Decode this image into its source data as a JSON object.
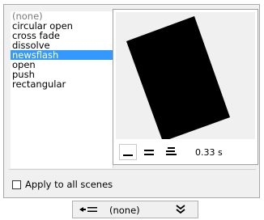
{
  "transitions": {
    "items": [
      "(none)",
      "circular open",
      "cross fade",
      "dissolve",
      "newsflash",
      "open",
      "push",
      "rectangular"
    ],
    "selected_index": 4
  },
  "preview": {
    "speeds": [
      "slow-icon",
      "medium-icon",
      "fast-icon"
    ],
    "active_speed_index": 0,
    "duration": "0.33 s"
  },
  "apply_all": {
    "label": "Apply to all scenes",
    "checked": false
  },
  "bottom": {
    "selection_label": "(none)",
    "arrow_icon": "transition-arrow-icon",
    "expand_icon": "double-chevron-down-icon"
  },
  "colors": {
    "selection": "#3399ff",
    "panel": "#f0f0f0"
  }
}
